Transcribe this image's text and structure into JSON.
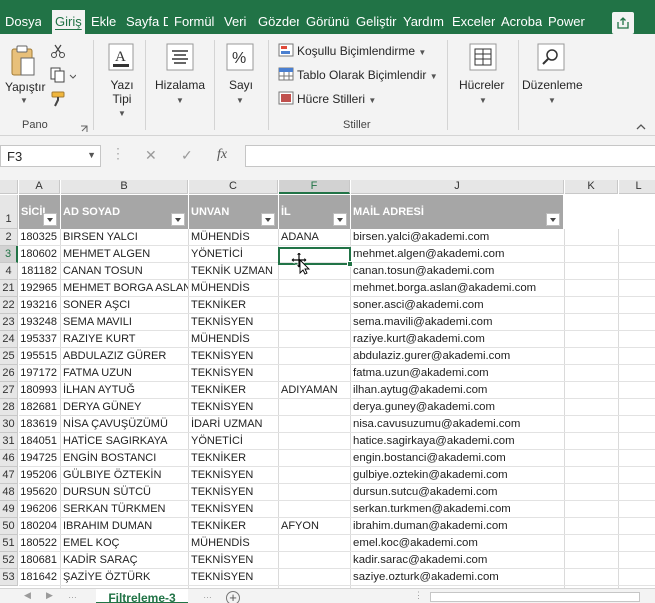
{
  "ribbon_tabs": [
    "Dosya",
    "Giriş",
    "Ekle",
    "Sayfa D",
    "Formül",
    "Veri",
    "Gözden",
    "Görünü",
    "Geliştir",
    "Yardım",
    "Exceler",
    "Acroba",
    "Power"
  ],
  "ribbon": {
    "clipboard": {
      "paste_label": "Yapıştır",
      "group_label": "Pano"
    },
    "font": {
      "label": "Yazı Tipi"
    },
    "alignment": {
      "label": "Hizalama"
    },
    "number": {
      "label": "Sayı"
    },
    "styles": {
      "conditional": "Koşullu Biçimlendirme",
      "table": "Tablo Olarak Biçimlendir",
      "cell_styles": "Hücre Stilleri",
      "group_label": "Stiller"
    },
    "cells": {
      "label": "Hücreler"
    },
    "editing": {
      "label": "Düzenleme"
    }
  },
  "formula_bar": {
    "name_box": "F3",
    "cancel": "✕",
    "enter": "✓",
    "fx": "fx",
    "value": ""
  },
  "grid": {
    "columns": [
      "A",
      "B",
      "C",
      "F",
      "J",
      "K",
      "L"
    ],
    "header_row_number": "1",
    "headers": [
      "SİCİL",
      "AD SOYAD",
      "UNVAN",
      "İL",
      "MAİL ADRESİ"
    ],
    "rows": [
      {
        "n": "2",
        "sicil": "180325",
        "name": "BIRSEN YALCI",
        "unvan": "MÜHENDİS",
        "il": "ADANA",
        "mail": "birsen.yalci@akademi.com"
      },
      {
        "n": "3",
        "sicil": "180602",
        "name": "MEHMET ALGEN",
        "unvan": "YÖNETİCİ",
        "il": "",
        "mail": "mehmet.algen@akademi.com"
      },
      {
        "n": "4",
        "sicil": "181182",
        "name": "CANAN TOSUN",
        "unvan": "TEKNİK UZMAN",
        "il": "",
        "mail": "canan.tosun@akademi.com"
      },
      {
        "n": "21",
        "sicil": "192965",
        "name": "MEHMET BORGA ASLAN",
        "unvan": "MÜHENDİS",
        "il": "",
        "mail": "mehmet.borga.aslan@akademi.com"
      },
      {
        "n": "22",
        "sicil": "193216",
        "name": "SONER AŞCI",
        "unvan": "TEKNİKER",
        "il": "",
        "mail": "soner.asci@akademi.com"
      },
      {
        "n": "23",
        "sicil": "193248",
        "name": "SEMA MAVILI",
        "unvan": "TEKNİSYEN",
        "il": "",
        "mail": "sema.mavili@akademi.com"
      },
      {
        "n": "24",
        "sicil": "195337",
        "name": "RAZIYE KURT",
        "unvan": "MÜHENDİS",
        "il": "",
        "mail": "raziye.kurt@akademi.com"
      },
      {
        "n": "25",
        "sicil": "195515",
        "name": "ABDULAZIZ GÜRER",
        "unvan": "TEKNİSYEN",
        "il": "",
        "mail": "abdulaziz.gurer@akademi.com"
      },
      {
        "n": "26",
        "sicil": "197172",
        "name": "FATMA UZUN",
        "unvan": "TEKNİSYEN",
        "il": "",
        "mail": "fatma.uzun@akademi.com"
      },
      {
        "n": "27",
        "sicil": "180993",
        "name": "İLHAN AYTUĞ",
        "unvan": "TEKNİKER",
        "il": "ADIYAMAN",
        "mail": "ilhan.aytug@akademi.com"
      },
      {
        "n": "28",
        "sicil": "182681",
        "name": "DERYA GÜNEY",
        "unvan": "TEKNİSYEN",
        "il": "",
        "mail": "derya.guney@akademi.com"
      },
      {
        "n": "30",
        "sicil": "183619",
        "name": "NİSA ÇAVUŞÜZÜMÜ",
        "unvan": "İDARİ UZMAN",
        "il": "",
        "mail": "nisa.cavusuzumu@akademi.com"
      },
      {
        "n": "31",
        "sicil": "184051",
        "name": "HATİCE SAGIRKAYA",
        "unvan": "YÖNETİCİ",
        "il": "",
        "mail": "hatice.sagirkaya@akademi.com"
      },
      {
        "n": "46",
        "sicil": "194725",
        "name": "ENGİN BOSTANCI",
        "unvan": "TEKNİKER",
        "il": "",
        "mail": "engin.bostanci@akademi.com"
      },
      {
        "n": "47",
        "sicil": "195206",
        "name": "GÜLBIYE ÖZTEKİN",
        "unvan": "TEKNİSYEN",
        "il": "",
        "mail": "gulbiye.oztekin@akademi.com"
      },
      {
        "n": "48",
        "sicil": "195620",
        "name": "DURSUN SÜTCÜ",
        "unvan": "TEKNİSYEN",
        "il": "",
        "mail": "dursun.sutcu@akademi.com"
      },
      {
        "n": "49",
        "sicil": "196206",
        "name": "SERKAN TÜRKMEN",
        "unvan": "TEKNİSYEN",
        "il": "",
        "mail": "serkan.turkmen@akademi.com"
      },
      {
        "n": "50",
        "sicil": "180204",
        "name": "IBRAHIM DUMAN",
        "unvan": "TEKNİKER",
        "il": "AFYON",
        "mail": "ibrahim.duman@akademi.com"
      },
      {
        "n": "51",
        "sicil": "180522",
        "name": "EMEL KOÇ",
        "unvan": "MÜHENDİS",
        "il": "",
        "mail": "emel.koc@akademi.com"
      },
      {
        "n": "52",
        "sicil": "180681",
        "name": "KADİR SARAÇ",
        "unvan": "TEKNİSYEN",
        "il": "",
        "mail": "kadir.sarac@akademi.com"
      },
      {
        "n": "53",
        "sicil": "181642",
        "name": "ŞAZİYE ÖZTÜRK",
        "unvan": "TEKNİSYEN",
        "il": "",
        "mail": "saziye.ozturk@akademi.com"
      }
    ]
  },
  "sheet_tab": "Filtreleme-3",
  "colors": {
    "accent": "#217346",
    "header_fill": "#a6a6a6"
  }
}
